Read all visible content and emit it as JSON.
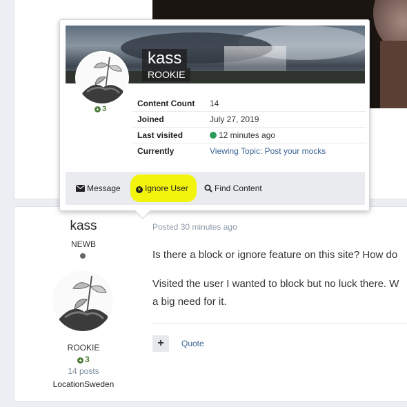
{
  "hovercard": {
    "username": "kass",
    "rank": "ROOKIE",
    "reputation": "3",
    "stats": [
      {
        "key": "Content Count",
        "value": "14"
      },
      {
        "key": "Joined",
        "value": "July 27, 2019"
      },
      {
        "key": "Last visited",
        "value": "12 minutes ago"
      },
      {
        "key": "Currently",
        "value": "Viewing Topic: Post your mocks"
      }
    ],
    "actions": {
      "message": "Message",
      "ignore": "Ignore User",
      "find": "Find Content"
    }
  },
  "post": {
    "author": {
      "name": "kass",
      "group": "NEWB",
      "title": "ROOKIE",
      "reputation": "3",
      "posts": "14 posts",
      "location": "LocationSweden"
    },
    "meta": "Posted 30 minutes ago",
    "paragraphs": [
      "Is there a block or ignore feature on this site? How do",
      "Visited the user I wanted to block but no luck there. W",
      "a big need for it."
    ],
    "plus_label": "+",
    "quote_label": "Quote"
  },
  "colors": {
    "highlight": "#f3f40b",
    "link": "#3d6594",
    "online": "#2e9b59",
    "reputation": "#4a7b36"
  },
  "icons": [
    "envelope-icon",
    "x-circle-icon",
    "search-icon",
    "plus-circle-icon"
  ]
}
